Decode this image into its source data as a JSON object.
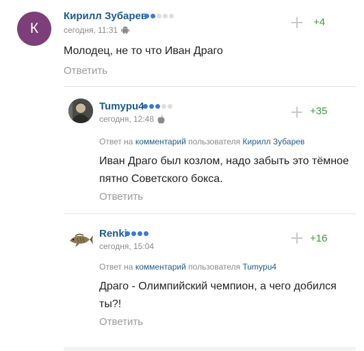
{
  "comments": [
    {
      "author": "Кирилл Зубарев",
      "avatar_letter": "К",
      "avatar_color": "#7c3f7a",
      "rank_dots": 2,
      "rank_total": 5,
      "time": "сегодня, 11:31",
      "device_icon": "android-icon",
      "score": "+4",
      "text": "Молодец, не то что Иван Драго",
      "reply_label": "Ответить"
    },
    {
      "author": "Tumypu4",
      "avatar_type": "photo",
      "rank_dots": 3,
      "rank_total": 5,
      "time": "сегодня, 12:48",
      "device_icon": "apple-icon",
      "score": "+35",
      "reply_prefix": "Ответ на",
      "reply_comment_link": "комментарий",
      "reply_user_prefix": "пользователя",
      "reply_user": "Кирилл Зубарев",
      "text_line1": "Иван Драго был козлом, надо забыть это тёмное",
      "text_line2": "пятно Советского бокса.",
      "reply_label": "Ответить"
    },
    {
      "author": "Renki",
      "avatar_type": "fish",
      "rank_dots": 4,
      "rank_total": 4,
      "time": "сегодня, 15:04",
      "device_icon": "",
      "score": "+16",
      "reply_prefix": "Ответ на",
      "reply_comment_link": "комментарий",
      "reply_user_prefix": "пользователя",
      "reply_user": "Tumypu4",
      "text_line1": "Драго - Олимпийский чемпион, а чего добился",
      "text_line2": "ты?!",
      "reply_label": "Ответить"
    }
  ],
  "colors": {
    "author": "#1e5a8a",
    "score_positive": "#3a9a3a",
    "rank_active": "#3a7bd5",
    "rank_inactive": "#dddddd",
    "meta": "#8a8a8a"
  }
}
